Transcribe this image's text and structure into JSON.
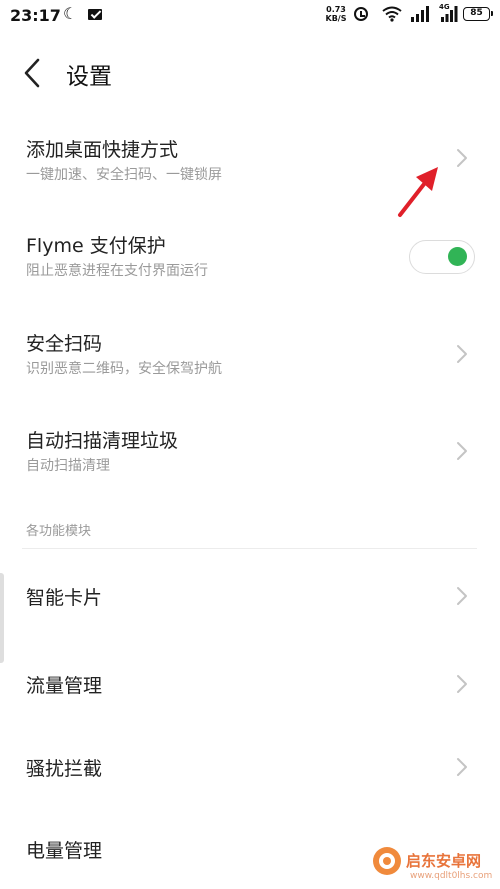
{
  "status_bar": {
    "time": "23:17",
    "net_speed_value": "0.73",
    "net_speed_unit": "KB/S",
    "network_type": "4G",
    "battery": "85"
  },
  "header": {
    "title": "设置"
  },
  "settings": [
    {
      "title": "添加桌面快捷方式",
      "subtitle": "一键加速、安全扫码、一键锁屏"
    },
    {
      "title": "Flyme 支付保护",
      "subtitle": "阻止恶意进程在支付界面运行",
      "toggle_on": true
    },
    {
      "title": "安全扫码",
      "subtitle": "识别恶意二维码，安全保驾护航"
    },
    {
      "title": "自动扫描清理垃圾",
      "subtitle": "自动扫描清理"
    }
  ],
  "section_header": "各功能模块",
  "modules": [
    {
      "title": "智能卡片"
    },
    {
      "title": "流量管理"
    },
    {
      "title": "骚扰拦截"
    },
    {
      "title": "电量管理"
    }
  ],
  "watermark": {
    "text": "启东安卓网",
    "url": "www.qdlt0lhs.com"
  },
  "colors": {
    "toggle_on": "#31b456",
    "arrow": "#e0202a",
    "chevron": "#c4c4c4"
  },
  "icons": [
    "moon-icon",
    "message-icon",
    "alarm-icon",
    "wifi-icon",
    "signal-icon",
    "battery-icon",
    "back-icon",
    "chevron-right-icon",
    "red-arrow-annotation"
  ]
}
